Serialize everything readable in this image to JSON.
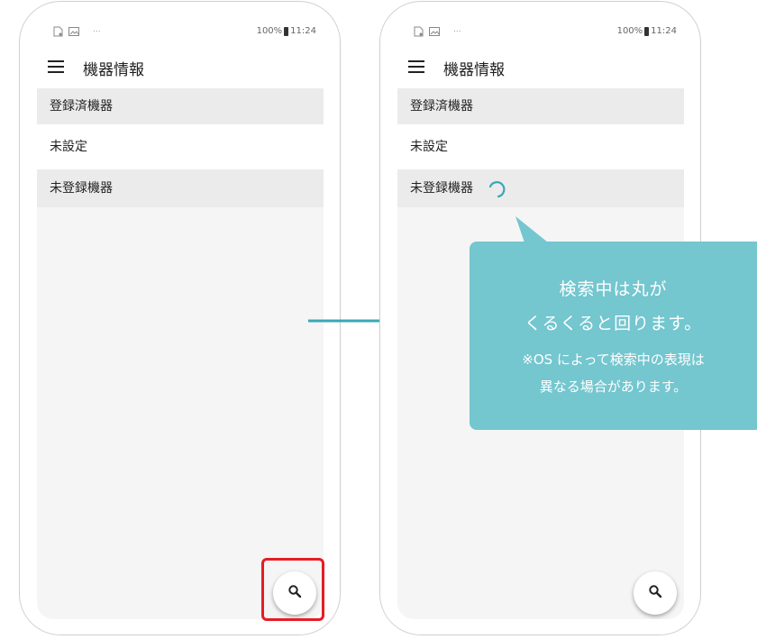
{
  "colors": {
    "accent": "#3aa7b5",
    "callout": "#74c6cf",
    "highlight": "#e51d24",
    "section_bg": "#ebebeb"
  },
  "left_screen": {
    "status": {
      "battery": "100%",
      "time": "11:24",
      "more": "..."
    },
    "appbar": {
      "menu_icon": "hamburger-menu-icon",
      "title": "機器情報"
    },
    "sections": {
      "registered_header": "登録済機器",
      "unset_item": "未設定",
      "unregistered_header": "未登録機器"
    },
    "fab_icon": "search-icon"
  },
  "right_screen": {
    "status": {
      "battery": "100%",
      "time": "11:24",
      "more": "..."
    },
    "appbar": {
      "menu_icon": "hamburger-menu-icon",
      "title": "機器情報"
    },
    "sections": {
      "registered_header": "登録済機器",
      "unset_item": "未設定",
      "unregistered_header": "未登録機器"
    },
    "spinner_icon": "loading-spinner-icon",
    "fab_icon": "search-icon"
  },
  "callout": {
    "line1": "検索中は丸が",
    "line2": "くるくると回ります。",
    "note1": "※OS によって検索中の表現は",
    "note2": "異なる場合があります。"
  }
}
